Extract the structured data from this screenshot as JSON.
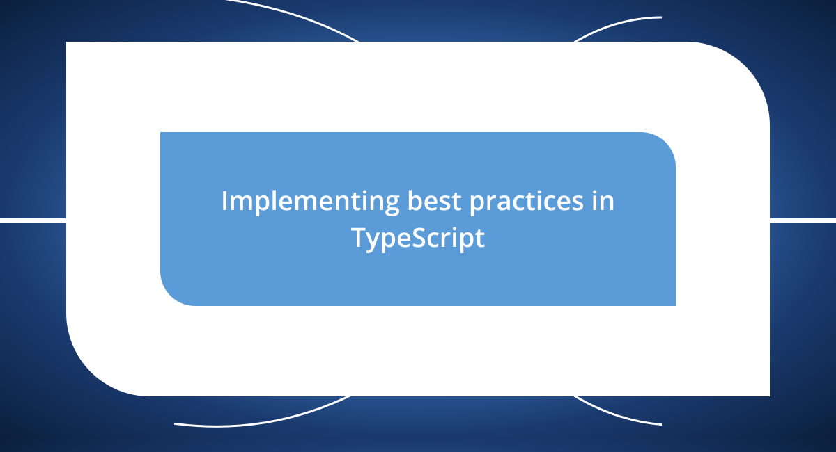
{
  "title": "Implementing best practices in TypeScript",
  "colors": {
    "background_dark": "#0a1f3d",
    "background_mid": "#1a3a6e",
    "background_light": "#5a9bd8",
    "frame": "#ffffff",
    "panel": "#5a9bd8",
    "text": "#ffffff"
  }
}
